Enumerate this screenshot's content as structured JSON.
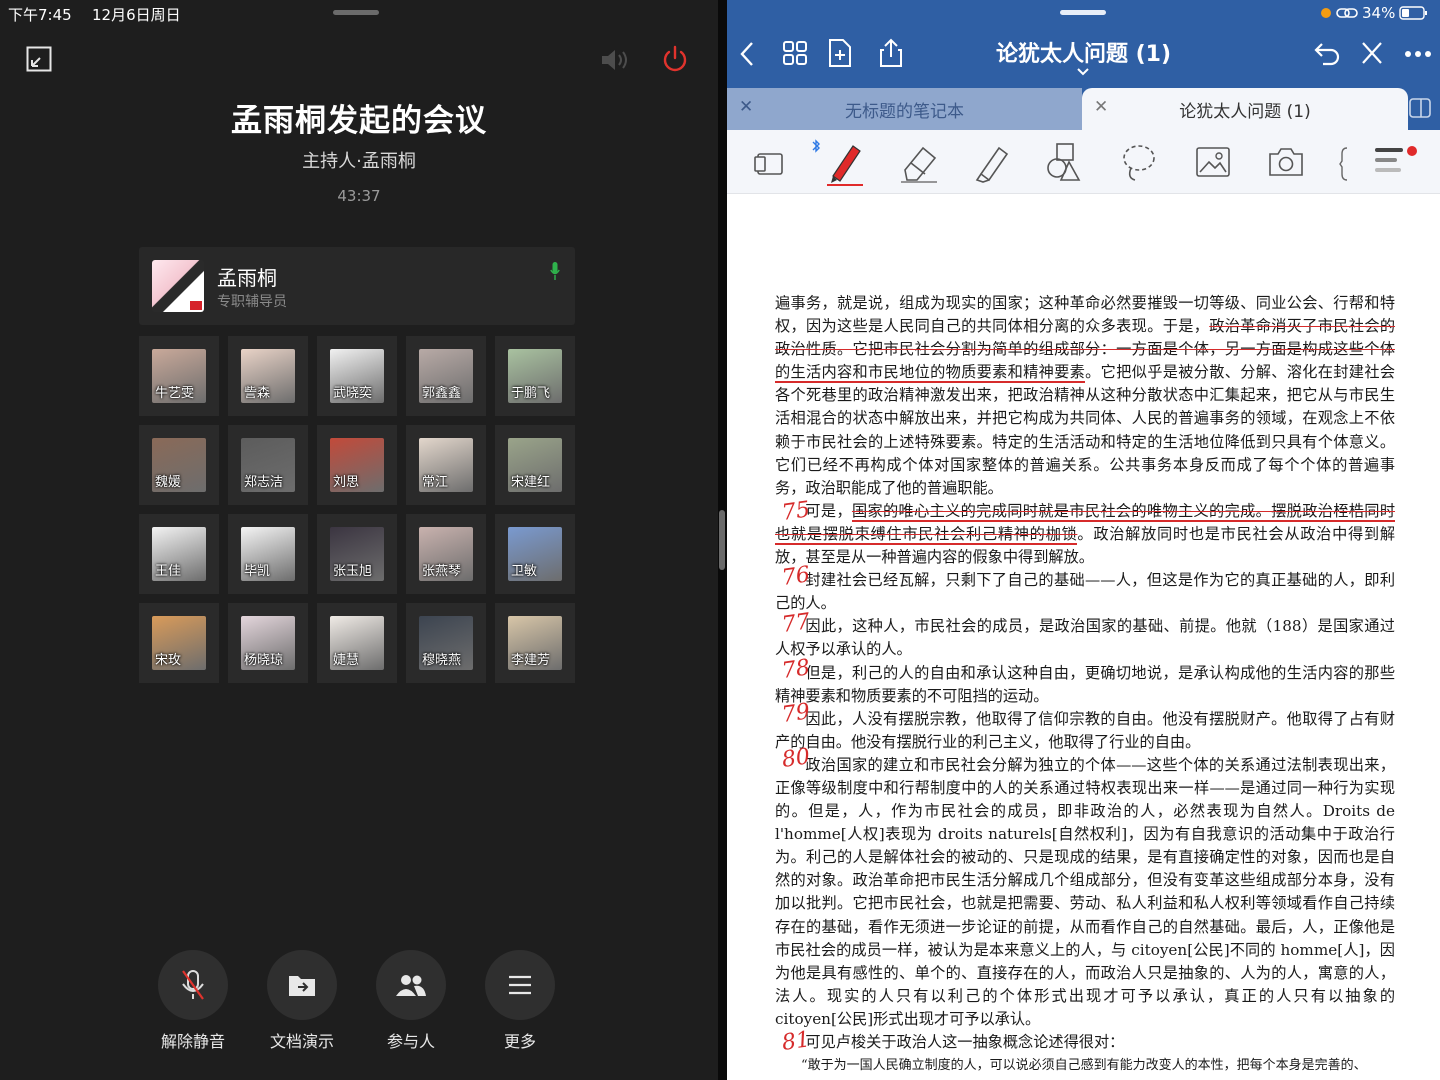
{
  "status_bar": {
    "time": "下午7:45",
    "date": "12月6日周日",
    "battery": "34%"
  },
  "meeting": {
    "title": "孟雨桐发起的会议",
    "host_line": "主持人·孟雨桐",
    "duration": "43:37",
    "host": {
      "name": "孟雨桐",
      "role": "专职辅导员"
    },
    "participants": [
      {
        "name": "牛艺雯",
        "color": "#c9a99a"
      },
      {
        "name": "訾森",
        "color": "#e9d3c7"
      },
      {
        "name": "武晓奕",
        "color": "#f1f1f1"
      },
      {
        "name": "郭鑫鑫",
        "color": "#b8aaa6"
      },
      {
        "name": "于鹏飞",
        "color": "#a9c2a0"
      },
      {
        "name": "魏媛",
        "color": "#8a6a58"
      },
      {
        "name": "郑志洁",
        "color": "#5c5c5c"
      },
      {
        "name": "刘思",
        "color": "#c24a3a"
      },
      {
        "name": "常江",
        "color": "#e3d7cc"
      },
      {
        "name": "宋建红",
        "color": "#9aa48a"
      },
      {
        "name": "王佳",
        "color": "#f3f3f3"
      },
      {
        "name": "毕凯",
        "color": "#f5f5f5"
      },
      {
        "name": "张玉旭",
        "color": "#3b3541"
      },
      {
        "name": "张燕琴",
        "color": "#c9b2ae"
      },
      {
        "name": "卫敏",
        "color": "#7a9ad0"
      },
      {
        "name": "宋玫",
        "color": "#d99b5a"
      },
      {
        "name": "杨晓琼",
        "color": "#e4d6dc"
      },
      {
        "name": "婕慧",
        "color": "#f0ebe6"
      },
      {
        "name": "穆晓燕",
        "color": "#3c4450"
      },
      {
        "name": "李建芳",
        "color": "#d8c6a8"
      }
    ],
    "controls": [
      {
        "label": "解除静音",
        "icon": "mic-muted-icon"
      },
      {
        "label": "文档演示",
        "icon": "share-folder-icon"
      },
      {
        "label": "参与人",
        "icon": "people-icon"
      },
      {
        "label": "更多",
        "icon": "menu-icon"
      }
    ]
  },
  "notes": {
    "title": "论犹太人问题 (1)",
    "tabs": [
      {
        "label": "无标题的笔记本",
        "active": false
      },
      {
        "label": "论犹太人问题 (1)",
        "active": true
      }
    ],
    "tools": [
      "page-layout-icon",
      "pen-icon",
      "eraser-icon",
      "highlighter-icon",
      "shapes-icon",
      "lasso-icon",
      "image-icon",
      "camera-icon",
      "more-tools-icon"
    ],
    "margin_numbers": [
      "75",
      "76",
      "77",
      "78",
      "79",
      "80",
      "81"
    ]
  },
  "document": {
    "p1_a": "遍事务，就是说，组成为现实的国家；这种革命必然要摧毁一切等级、同业公会、行帮和特权，因为这些是人民同自己的共同体相分离的众多表现。于是，",
    "p1_strike": "政治革命消灭了市民社会的政治性质。它把市民社会分割为简单的组成部分：一方面是个体，另一方面是构成这些个体",
    "p1_ul": "的生活内容和市民地位的物质要素和精神要素",
    "p1_b": "。它把似乎是被分散、分解、溶化在封建社会各个死巷里的政治精神激发出来，把政治精神从这种分散状态中汇集起来，把它从与市民生活相混合的状态中解放出来，并把它构成为共同体、人民的普遍事务的领域，在观念上不依赖于市民社会的上述特殊要素。特定的生活活动和特定的生活地位降低到只具有个体意义。它们已经不再构成个体对国家整体的普遍关系。公共事务本身反而成了每个个体的普遍事务，政治职能成了他的普遍职能。",
    "p2_a": "可是，",
    "p2_hl": "国家的唯心主义的完成同时就是市民社会的唯物主义的完成。摆脱政治桎梏同时也就是摆脱束缚住市民社会利己精神的枷锁",
    "p2_b": "。政治解放同时也是市民社会从政治中得到解放，甚至是从一种普遍内容的假象中得到解放。",
    "p3": "封建社会已经瓦解，只剩下了自己的基础——人，但这是作为它的真正基础的人，即利己的人。",
    "p4": "因此，这种人，市民社会的成员，是政治国家的基础、前提。他就（188）是国家通过人权予以承认的人。",
    "p5": "但是，利己的人的自由和承认这种自由，更确切地说，是承认构成他的生活内容的那些精神要素和物质要素的不可阻挡的运动。",
    "p6": "因此，人没有摆脱宗教，他取得了信仰宗教的自由。他没有摆脱财产。他取得了占有财产的自由。他没有摆脱行业的利己主义，他取得了行业的自由。",
    "p7": "政治国家的建立和市民社会分解为独立的个体——这些个体的关系通过法制表现出来，正像等级制度中和行帮制度中的人的关系通过特权表现出来一样——是通过同一种行为实现的。但是，人，作为市民社会的成员，即非政治的人，必然表现为自然人。Droits de l'homme[人权]表现为 droits naturels[自然权利]，因为有自我意识的活动集中于政治行为。利己的人是解体社会的被动的、只是现成的结果，是有直接确定性的对象，因而也是自然的对象。政治革命把市民生活分解成几个组成部分，但没有变革这些组成部分本身，没有加以批判。它把市民社会，也就是把需要、劳动、私人利益和私人权利等领域看作自己持续存在的基础，看作无须进一步论证的前提，从而看作自己的自然基础。最后，人，正像他是市民社会的成员一样，被认为是本来意义上的人，与 citoyen[公民]不同的 homme[人]，因为他是具有感性的、单个的、直接存在的人，而政治人只是抽象的、人为的人，寓意的人，法人。现实的人只有以利己的个体形式出现才可予以承认，真正的人只有以抽象的 citoyen[公民]形式出现才可予以承认。",
    "p8": "可见卢梭关于政治人这一抽象概念论述得很对：",
    "p9": "“敢于为一国人民确立制度的人，可以说必须自己感到有能力改变人的本性，把每个本身是完善的、"
  }
}
